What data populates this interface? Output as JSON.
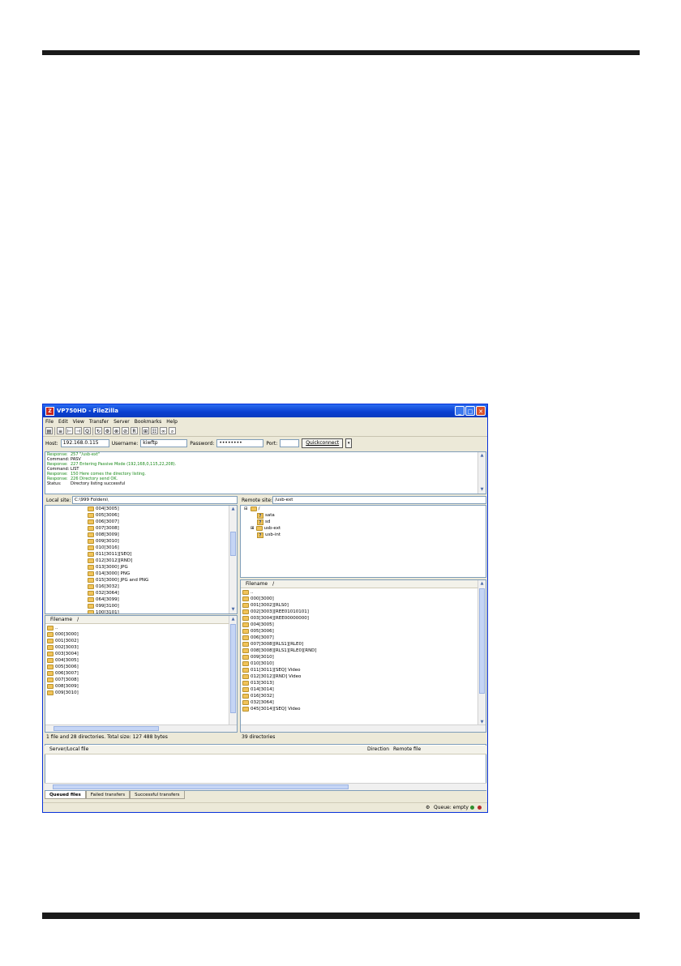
{
  "window": {
    "title": "VP750HD - FileZilla",
    "controls": [
      "_",
      "□",
      "✕"
    ]
  },
  "menu": [
    "File",
    "Edit",
    "View",
    "Transfer",
    "Server",
    "Bookmarks",
    "Help"
  ],
  "quickconnect": {
    "host_label": "Host:",
    "host": "192.168.0.115",
    "user_label": "Username:",
    "user": "kiwftp",
    "pass_label": "Password:",
    "pass": "••••••••",
    "port_label": "Port:",
    "port": "",
    "button": "Quickconnect",
    "dropdown": "▾"
  },
  "log": [
    {
      "k": "Response:",
      "v": "257 \"/usb-ext\"",
      "green": true
    },
    {
      "k": "Command:",
      "v": "PASV",
      "green": false
    },
    {
      "k": "Response:",
      "v": "227 Entering Passive Mode (192,168,0,115,22,208).",
      "green": true
    },
    {
      "k": "Command:",
      "v": "LIST",
      "green": false
    },
    {
      "k": "Response:",
      "v": "150 Here comes the directory listing.",
      "green": true
    },
    {
      "k": "Response:",
      "v": "226 Directory send OK.",
      "green": true
    },
    {
      "k": "Status:",
      "v": "Directory listing successful",
      "green": false
    }
  ],
  "local": {
    "label": "Local site:",
    "path": "C:\\999 Folders\\",
    "tree": [
      "004[3005]",
      "005[3006]",
      "006[3007]",
      "007[3008]",
      "008[3009]",
      "009[3010]",
      "010[3016]",
      "011[3011][SEQ]",
      "012[3012][RND]",
      "013[3000] JPG",
      "014[3000] PNG",
      "015[3000] JPG and PNG",
      "016[3032]",
      "032[3064]",
      "064[3099]",
      "099[3100]",
      "100[3101]",
      "101[3127]",
      "127[3128]"
    ],
    "file_header": "Filename",
    "sort_indicator": "/",
    "files": [
      "..",
      "000[3000]",
      "001[3002]",
      "002[3003]",
      "003[3004]",
      "004[3005]",
      "005[3006]",
      "006[3007]",
      "007[3008]",
      "008[3009]",
      "009[3010]"
    ],
    "status": "1 file and 28 directories. Total size: 127 488 bytes"
  },
  "remote": {
    "label": "Remote site:",
    "path": "/usb-ext",
    "tree_root": "/",
    "tree": [
      "sata",
      "sd",
      "usb-ext",
      "usb-int"
    ],
    "file_header": "Filename",
    "sort_indicator": "/",
    "files": [
      "..",
      "000[3000]",
      "001[3002][RLS0]",
      "002[3003][REE01010101]",
      "003[3004][REE00000000]",
      "004[3005]",
      "005[3006]",
      "006[3007]",
      "007[3008][RLS1][RLE0]",
      "008[3008][RLS1][RLE0][RND]",
      "009[3010]",
      "010[3010]",
      "011[3011][SEQ] Video",
      "012[3012][RND] Video",
      "013[3013]",
      "014[3014]",
      "016[3032]",
      "032[3064]",
      "045[3014][SEQ] Video"
    ],
    "status": "39 directories"
  },
  "queue": {
    "columns": [
      "Server/Local file",
      "Direction",
      "Remote file"
    ],
    "tabs": [
      "Queued files",
      "Failed transfers",
      "Successful transfers"
    ],
    "status": "Queue: empty"
  },
  "colors": {
    "title_blue": "#0a3fd0",
    "log_green": "#1a8a1a",
    "folder": "#f1c35a"
  }
}
